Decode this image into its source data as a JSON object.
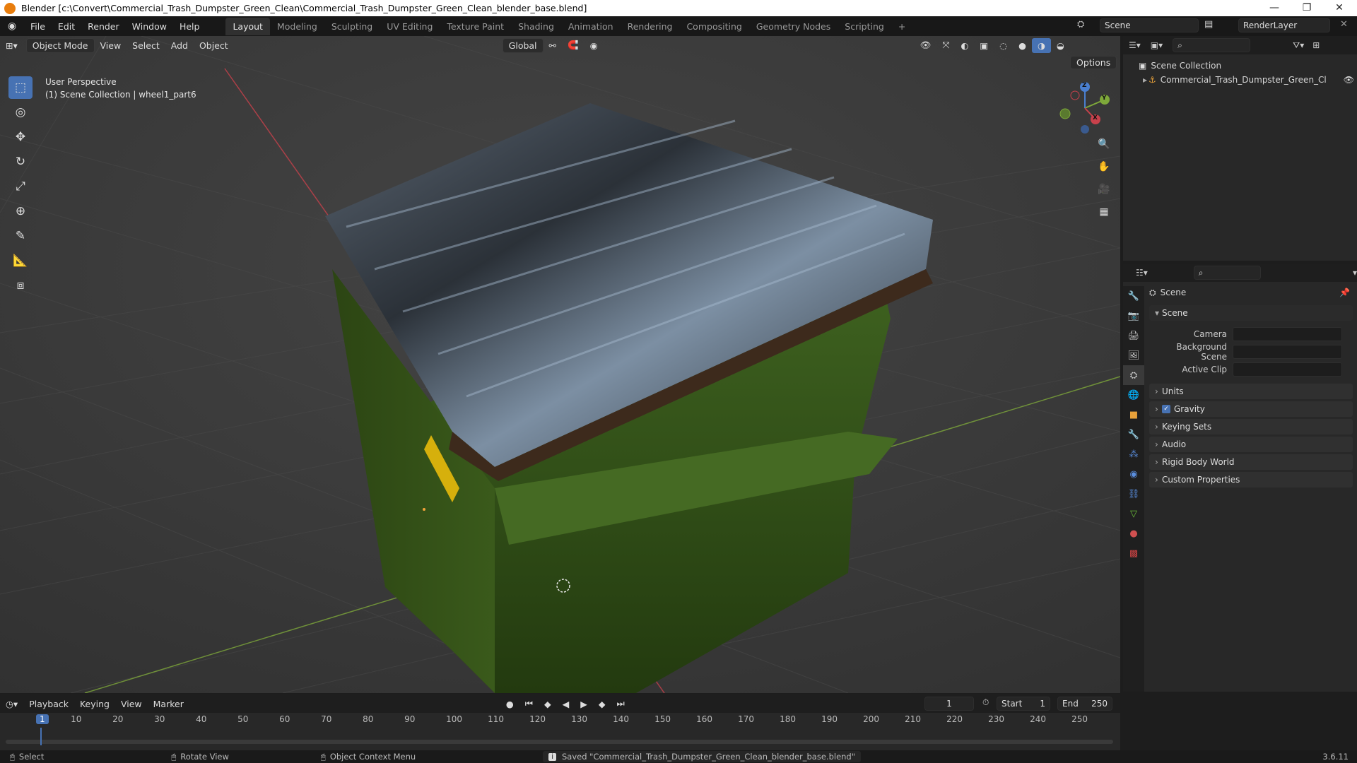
{
  "window": {
    "title": "Blender [c:\\Convert\\Commercial_Trash_Dumpster_Green_Clean\\Commercial_Trash_Dumpster_Green_Clean_blender_base.blend]",
    "minimize": "—",
    "maximize": "❐",
    "close": "✕"
  },
  "menus": [
    "File",
    "Edit",
    "Render",
    "Window",
    "Help"
  ],
  "workspaces": [
    "Layout",
    "Modeling",
    "Sculpting",
    "UV Editing",
    "Texture Paint",
    "Shading",
    "Animation",
    "Rendering",
    "Compositing",
    "Geometry Nodes",
    "Scripting"
  ],
  "active_workspace": "Layout",
  "add_workspace": "+",
  "scene_field": "Scene",
  "render_layer_field": "RenderLayer",
  "viewport": {
    "mode": "Object Mode",
    "menus": [
      "View",
      "Select",
      "Add",
      "Object"
    ],
    "orientation": "Global",
    "options": "Options",
    "perspective_label": "User Perspective",
    "collection_label": "(1) Scene Collection | wheel1_part6",
    "gizmo": {
      "z": "Z",
      "y": "Y",
      "x": "X"
    }
  },
  "outliner": {
    "root": "Scene Collection",
    "items": [
      "Commercial_Trash_Dumpster_Green_Cl"
    ]
  },
  "properties": {
    "header": "Scene",
    "panel": "Scene",
    "rows": [
      {
        "label": "Camera"
      },
      {
        "label": "Background Scene"
      },
      {
        "label": "Active Clip"
      }
    ],
    "sections": [
      "Units",
      "Gravity",
      "Keying Sets",
      "Audio",
      "Rigid Body World",
      "Custom Properties"
    ],
    "gravity_checked": true
  },
  "timeline": {
    "menus": [
      "Playback",
      "Keying",
      "View",
      "Marker"
    ],
    "current_frame": "1",
    "start_label": "Start",
    "start": "1",
    "end_label": "End",
    "end": "250",
    "ticks": [
      "1",
      "10",
      "20",
      "30",
      "40",
      "50",
      "60",
      "70",
      "80",
      "90",
      "100",
      "110",
      "120",
      "130",
      "140",
      "150",
      "160",
      "170",
      "180",
      "190",
      "200",
      "210",
      "220",
      "230",
      "240",
      "250"
    ]
  },
  "status": {
    "select": "Select",
    "rotate": "Rotate View",
    "context": "Object Context Menu",
    "message": "Saved \"Commercial_Trash_Dumpster_Green_Clean_blender_base.blend\"",
    "version": "3.6.11"
  },
  "colors": {
    "accent": "#4772b3",
    "dumpster_green": "#3b5a1c",
    "lid_black": "#2a2e33",
    "x_axis": "#c8414b",
    "y_axis": "#7ea83a",
    "z_axis": "#4a7fd0"
  }
}
